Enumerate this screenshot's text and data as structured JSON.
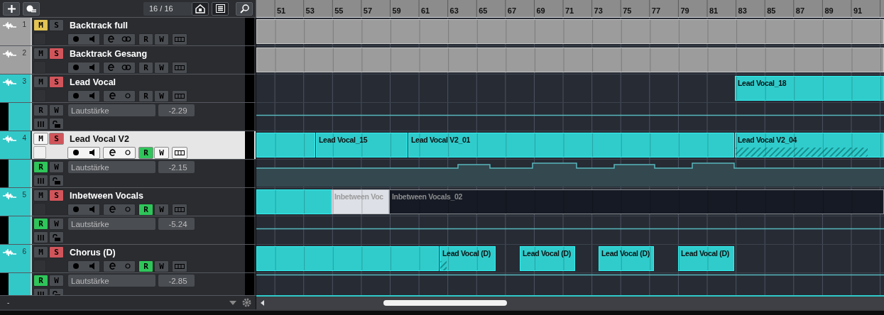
{
  "toolbar": {
    "counter": "16 / 16"
  },
  "ruler": {
    "bars": [
      "51",
      "53",
      "55",
      "57",
      "59",
      "61",
      "63",
      "65",
      "67",
      "69",
      "71",
      "73",
      "75",
      "77",
      "79",
      "81",
      "83",
      "85",
      "87",
      "89",
      "91"
    ]
  },
  "tracks": [
    {
      "number": "1",
      "name": "Backtrack full",
      "color": "#a0a0a0",
      "selected": false,
      "linked": true,
      "mute": {
        "label": "M",
        "on": true
      },
      "solo": {
        "label": "S",
        "on": false
      },
      "read": {
        "label": "R",
        "on": false
      },
      "write": {
        "label": "W",
        "on": false
      },
      "clips": [
        {
          "kind": "region"
        }
      ]
    },
    {
      "number": "2",
      "name": "Backtrack Gesang",
      "color": "#a0a0a0",
      "selected": false,
      "linked": true,
      "mute": {
        "label": "M",
        "on": false
      },
      "solo": {
        "label": "S",
        "on": true
      },
      "read": {
        "label": "R",
        "on": false
      },
      "write": {
        "label": "W",
        "on": false
      },
      "clips": [
        {
          "kind": "region"
        }
      ]
    },
    {
      "number": "3",
      "name": "Lead Vocal",
      "color": "#32c8c8",
      "selected": false,
      "linked": false,
      "mute": {
        "label": "M",
        "on": false
      },
      "solo": {
        "label": "S",
        "on": true
      },
      "read": {
        "label": "R",
        "on": false
      },
      "write": {
        "label": "W",
        "on": false
      },
      "clips": [
        {
          "kind": "audio",
          "name": "Lead Vocal_18"
        }
      ],
      "automation": {
        "parameter": "Lautstärke",
        "value": "-2.29",
        "kind": "flat",
        "read": {
          "label": "R",
          "on": false
        },
        "write": {
          "label": "W",
          "on": false
        }
      }
    },
    {
      "number": "4",
      "name": "Lead Vocal V2",
      "color": "#32c8c8",
      "selected": true,
      "linked": false,
      "mute": {
        "label": "M",
        "on": false
      },
      "solo": {
        "label": "S",
        "on": true
      },
      "read": {
        "label": "R",
        "on": true
      },
      "write": {
        "label": "W",
        "on": false
      },
      "clips": [
        {
          "kind": "audio"
        },
        {
          "kind": "audio",
          "name": "Lead Vocal_15"
        },
        {
          "kind": "audio",
          "name": "Lead Vocal V2_01"
        },
        {
          "kind": "audio",
          "name": "Lead Vocal V2_04",
          "hatched": true
        }
      ],
      "automation": {
        "parameter": "Lautstärke",
        "value": "-2.15",
        "kind": "steps",
        "read": {
          "label": "R",
          "on": true
        },
        "write": {
          "label": "W",
          "on": false
        }
      }
    },
    {
      "number": "5",
      "name": "Inbetween Vocals",
      "color": "#32c8c8",
      "selected": false,
      "linked": false,
      "mute": {
        "label": "M",
        "on": false
      },
      "solo": {
        "label": "S",
        "on": true
      },
      "read": {
        "label": "R",
        "on": true
      },
      "write": {
        "label": "W",
        "on": false
      },
      "clips": [
        {
          "kind": "audio"
        },
        {
          "kind": "light",
          "name": "Inbetween Voc"
        },
        {
          "kind": "dark",
          "name": "Inbetween Vocals_02"
        }
      ],
      "automation": {
        "parameter": "Lautstärke",
        "value": "-5.24",
        "kind": "flat",
        "read": {
          "label": "R",
          "on": true
        },
        "write": {
          "label": "W",
          "on": false
        }
      }
    },
    {
      "number": "6",
      "name": "Chorus (D)",
      "color": "#32c8c8",
      "selected": false,
      "linked": false,
      "mute": {
        "label": "M",
        "on": false
      },
      "solo": {
        "label": "S",
        "on": true
      },
      "read": {
        "label": "R",
        "on": true
      },
      "write": {
        "label": "W",
        "on": false
      },
      "clips": [
        {
          "kind": "audio"
        },
        {
          "kind": "audio",
          "name": "Lead Vocal (D)",
          "hatched": true
        },
        {
          "kind": "audio",
          "name": "Lead Vocal (D)"
        },
        {
          "kind": "audio",
          "name": "Lead Vocal (D)"
        },
        {
          "kind": "audio",
          "name": "Lead Vocal (D)"
        }
      ],
      "automation": {
        "parameter": "Lautstärke",
        "value": "-2.85",
        "kind": "top",
        "read": {
          "label": "R",
          "on": true
        },
        "write": {
          "label": "W",
          "on": false
        }
      }
    }
  ],
  "bottom_bar": {
    "label": "-"
  }
}
